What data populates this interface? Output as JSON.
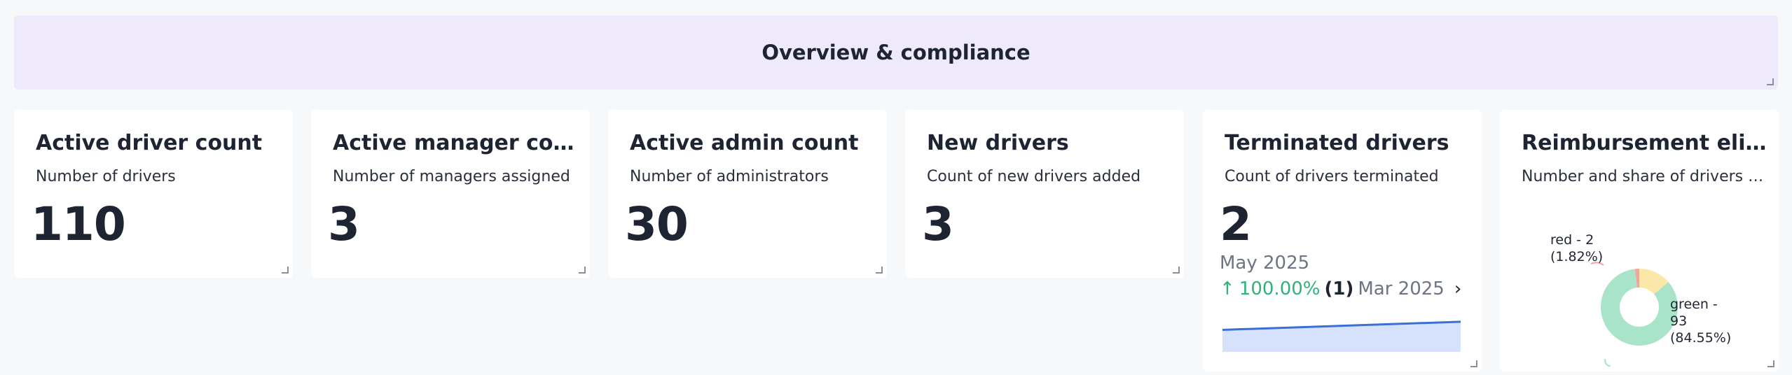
{
  "header": {
    "title": "Overview & compliance"
  },
  "cards": [
    {
      "title": "Active driver count",
      "subtitle": "Number of drivers",
      "value": "110"
    },
    {
      "title": "Active manager count",
      "subtitle": "Number of managers assigned",
      "value": "3"
    },
    {
      "title": "Active admin count",
      "subtitle": "Number of administrators",
      "value": "30"
    },
    {
      "title": "New drivers",
      "subtitle": "Count of new drivers added",
      "value": "3"
    },
    {
      "title": "Terminated drivers",
      "subtitle": "Count of drivers terminated",
      "value": "2",
      "period": "May 2025",
      "trend": {
        "arrow": "↑",
        "percent": "100.00%",
        "count": "(1)",
        "previous_period": "Mar 2025"
      },
      "sparkline": [
        1,
        2
      ]
    },
    {
      "title": "Reimbursement eligibility",
      "subtitle": "Number and share of drivers by status",
      "donut": [
        {
          "label": "red - 2\n(1.82%)",
          "value": 2,
          "color": "#f4a3a3"
        },
        {
          "label": "yellow",
          "value": 15,
          "color": "#fbe7a7"
        },
        {
          "label": "green -\n93\n(84.55%)",
          "value": 93,
          "color": "#a9e4c8"
        }
      ]
    }
  ],
  "colors": {
    "accent_green": "#2fb37a",
    "sparkline_line": "#3b6fd8",
    "sparkline_fill": "#d6e2fb",
    "header_bg": "#eeeafb"
  }
}
